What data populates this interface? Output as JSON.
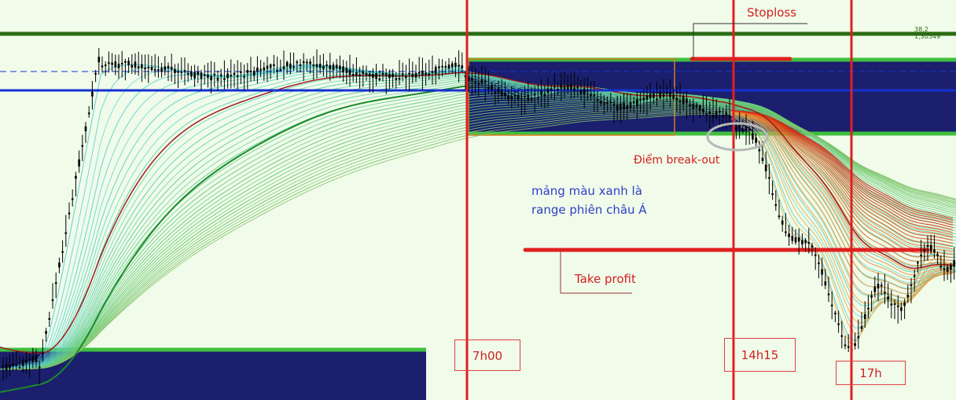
{
  "chart_data": {
    "type": "line",
    "title": "",
    "xlabel": "",
    "ylabel": "",
    "grid": false,
    "chart_label_text": "38,2 1,30549",
    "session_markers": [
      {
        "label": "7h00",
        "color": "#e02020"
      },
      {
        "label": "14h15",
        "color": "#e02020"
      },
      {
        "label": "17h",
        "color": "#e02020"
      }
    ],
    "annotations": {
      "stoploss": "Stoploss",
      "breakout": "Điểm break-out",
      "asia_range_line1": "mảng màu xanh là",
      "asia_range_line2": "range phiên châu Á",
      "take_profit": "Take profit"
    },
    "colors": {
      "background": "#f0fbea",
      "range_box": "#1b1f6e",
      "range_border": "#3fbf3f",
      "resistance": "#2a6b12",
      "support_blue": "#1530d0",
      "marker_red": "#e02020",
      "label_red": "#d42020",
      "label_blue": "#2f3fc8",
      "candle": "#000000",
      "ribbon_cool": "#22c8e0",
      "ribbon_warm": "#e8a020"
    }
  }
}
